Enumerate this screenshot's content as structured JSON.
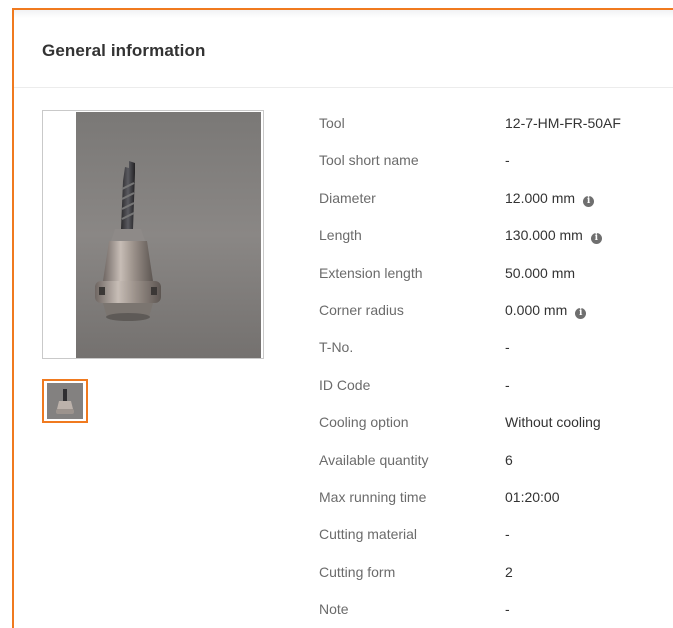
{
  "panel": {
    "title": "General information"
  },
  "gallery": {
    "main_image_icon": "tool-photo",
    "thumbnails": [
      {
        "icon": "tool-photo-thumbnail",
        "selected": true
      }
    ]
  },
  "properties": [
    {
      "label": "Tool",
      "value": "12-7-HM-FR-50AF",
      "info": false
    },
    {
      "label": "Tool short name",
      "value": "-",
      "info": false
    },
    {
      "label": "Diameter",
      "value": "12.000 mm",
      "info": true
    },
    {
      "label": "Length",
      "value": "130.000 mm",
      "info": true
    },
    {
      "label": "Extension length",
      "value": "50.000 mm",
      "info": false
    },
    {
      "label": "Corner radius",
      "value": "0.000 mm",
      "info": true
    },
    {
      "label": "T-No.",
      "value": "-",
      "info": false
    },
    {
      "label": "ID Code",
      "value": "-",
      "info": false
    },
    {
      "label": "Cooling option",
      "value": "Without cooling",
      "info": false
    },
    {
      "label": "Available quantity",
      "value": "6",
      "info": false
    },
    {
      "label": "Max running time",
      "value": "01:20:00",
      "info": false
    },
    {
      "label": "Cutting material",
      "value": "-",
      "info": false
    },
    {
      "label": "Cutting form",
      "value": "2",
      "info": false
    },
    {
      "label": "Note",
      "value": "-",
      "info": false
    }
  ],
  "icons": {
    "info": "info-icon",
    "info_glyph": "i"
  },
  "colors": {
    "accent": "#f07a1f",
    "label": "#6b6b6b",
    "value": "#333333"
  }
}
